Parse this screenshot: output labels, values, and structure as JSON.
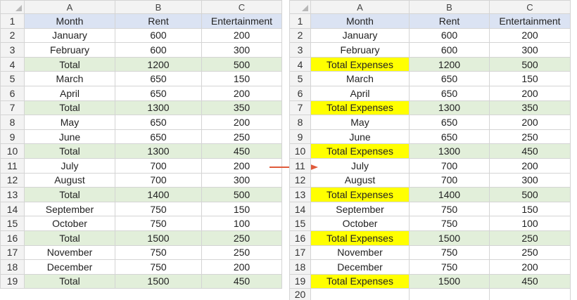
{
  "colors": {
    "header_row": "#dbe3f3",
    "total_row": "#e2efda",
    "highlight": "#ffff00",
    "arrow": "#e05a3a"
  },
  "left_sheet": {
    "columns": [
      "A",
      "B",
      "C"
    ],
    "rows": [
      {
        "n": "1",
        "a": "Month",
        "b": "Rent",
        "c": "Entertainment"
      },
      {
        "n": "2",
        "a": "January",
        "b": "600",
        "c": "200"
      },
      {
        "n": "3",
        "a": "February",
        "b": "600",
        "c": "300"
      },
      {
        "n": "4",
        "a": "Total",
        "b": "1200",
        "c": "500"
      },
      {
        "n": "5",
        "a": "March",
        "b": "650",
        "c": "150"
      },
      {
        "n": "6",
        "a": "April",
        "b": "650",
        "c": "200"
      },
      {
        "n": "7",
        "a": "Total",
        "b": "1300",
        "c": "350"
      },
      {
        "n": "8",
        "a": "May",
        "b": "650",
        "c": "200"
      },
      {
        "n": "9",
        "a": "June",
        "b": "650",
        "c": "250"
      },
      {
        "n": "10",
        "a": "Total",
        "b": "1300",
        "c": "450"
      },
      {
        "n": "11",
        "a": "July",
        "b": "700",
        "c": "200"
      },
      {
        "n": "12",
        "a": "August",
        "b": "700",
        "c": "300"
      },
      {
        "n": "13",
        "a": "Total",
        "b": "1400",
        "c": "500"
      },
      {
        "n": "14",
        "a": "September",
        "b": "750",
        "c": "150"
      },
      {
        "n": "15",
        "a": "October",
        "b": "750",
        "c": "100"
      },
      {
        "n": "16",
        "a": "Total",
        "b": "1500",
        "c": "250"
      },
      {
        "n": "17",
        "a": "November",
        "b": "750",
        "c": "250"
      },
      {
        "n": "18",
        "a": "December",
        "b": "750",
        "c": "200"
      },
      {
        "n": "19",
        "a": "Total",
        "b": "1500",
        "c": "450"
      }
    ]
  },
  "right_sheet": {
    "columns": [
      "A",
      "B",
      "C"
    ],
    "rows": [
      {
        "n": "1",
        "a": "Month",
        "b": "Rent",
        "c": "Entertainment"
      },
      {
        "n": "2",
        "a": "January",
        "b": "600",
        "c": "200"
      },
      {
        "n": "3",
        "a": "February",
        "b": "600",
        "c": "300"
      },
      {
        "n": "4",
        "a": "Total Expenses",
        "b": "1200",
        "c": "500"
      },
      {
        "n": "5",
        "a": "March",
        "b": "650",
        "c": "150"
      },
      {
        "n": "6",
        "a": "April",
        "b": "650",
        "c": "200"
      },
      {
        "n": "7",
        "a": "Total Expenses",
        "b": "1300",
        "c": "350"
      },
      {
        "n": "8",
        "a": "May",
        "b": "650",
        "c": "200"
      },
      {
        "n": "9",
        "a": "June",
        "b": "650",
        "c": "250"
      },
      {
        "n": "10",
        "a": "Total Expenses",
        "b": "1300",
        "c": "450"
      },
      {
        "n": "11",
        "a": "July",
        "b": "700",
        "c": "200"
      },
      {
        "n": "12",
        "a": "August",
        "b": "700",
        "c": "300"
      },
      {
        "n": "13",
        "a": "Total Expenses",
        "b": "1400",
        "c": "500"
      },
      {
        "n": "14",
        "a": "September",
        "b": "750",
        "c": "150"
      },
      {
        "n": "15",
        "a": "October",
        "b": "750",
        "c": "100"
      },
      {
        "n": "16",
        "a": "Total Expenses",
        "b": "1500",
        "c": "250"
      },
      {
        "n": "17",
        "a": "November",
        "b": "750",
        "c": "250"
      },
      {
        "n": "18",
        "a": "December",
        "b": "750",
        "c": "200"
      },
      {
        "n": "19",
        "a": "Total Expenses",
        "b": "1500",
        "c": "450"
      },
      {
        "n": "20",
        "a": "",
        "b": "",
        "c": ""
      }
    ]
  }
}
